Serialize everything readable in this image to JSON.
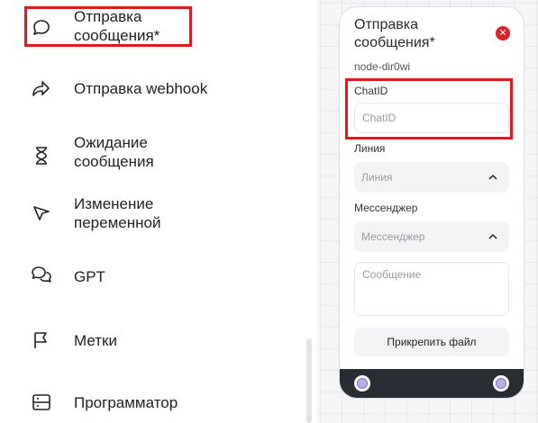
{
  "sidebar": {
    "items": [
      {
        "icon": "chat-bubble-icon",
        "label_line1": "Отправка",
        "label_line2": "сообщения*"
      },
      {
        "icon": "forward-arrow-icon",
        "label_line1": "Отправка webhook"
      },
      {
        "icon": "hourglass-icon",
        "label_line1": "Ожидание",
        "label_line2": "сообщения"
      },
      {
        "icon": "cursor-arrow-icon",
        "label_line1": "Изменение",
        "label_line2": "переменной"
      },
      {
        "icon": "chat-bubbles-icon",
        "label_line1": "GPT"
      },
      {
        "icon": "flag-icon",
        "label_line1": "Метки"
      },
      {
        "icon": "server-icon",
        "label_line1": "Программатор"
      }
    ]
  },
  "node": {
    "title_line1": "Отправка",
    "title_line2": "сообщения*",
    "id": "node-dir0wi",
    "chat_id": {
      "label": "ChatID",
      "placeholder": "ChatID",
      "value": ""
    },
    "line": {
      "label": "Линия",
      "placeholder": "Линия"
    },
    "messenger": {
      "label": "Мессенджер",
      "placeholder": "Мессенджер"
    },
    "message": {
      "placeholder": "Сообщение",
      "value": ""
    },
    "attach_label": "Прикрепить файл"
  },
  "colors": {
    "highlight": "#e8141b",
    "close": "#e01e26",
    "footer": "#2a2c33",
    "port": "#b9b0e6"
  }
}
